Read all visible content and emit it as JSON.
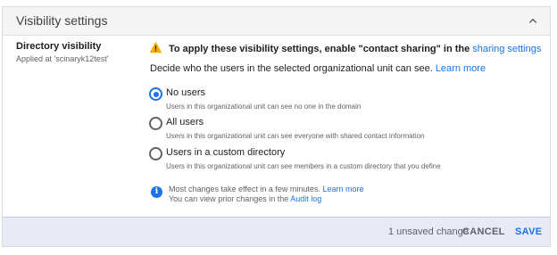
{
  "header": {
    "title": "Visibility settings",
    "collapse_icon": "chevron-up-icon"
  },
  "left": {
    "title": "Directory visibility",
    "applied": "Applied at 'scinaryk12test'"
  },
  "warning": {
    "icon": "warning-icon",
    "color": "#f9ab00",
    "text": "To apply these visibility settings, enable \"contact sharing\" in the ",
    "link": "sharing settings"
  },
  "description": {
    "text": "Decide who the users in the selected organizational unit can see. ",
    "link": "Learn more"
  },
  "options": [
    {
      "label": "No users",
      "sub": "Users in this organizational unit can see no one in the domain",
      "checked": true
    },
    {
      "label": "All users",
      "sub": "Users in this organizational unit can see everyone with shared contact information",
      "checked": false
    },
    {
      "label": "Users in a custom directory",
      "sub": "Users in this organizational unit can see members in a custom directory that you define",
      "checked": false
    }
  ],
  "info": {
    "icon": "info-icon",
    "line1_text": "Most changes take effect in a few minutes. ",
    "line1_link": "Learn more",
    "line2_text": "You can view prior changes in the ",
    "line2_link": "Audit log"
  },
  "footer": {
    "unsaved": "1 unsaved change",
    "cancel": "CANCEL",
    "save": "SAVE"
  },
  "colors": {
    "accent": "#1a73e8",
    "footer_bg": "#e8eaf6",
    "header_bg": "#f5f5f5"
  }
}
